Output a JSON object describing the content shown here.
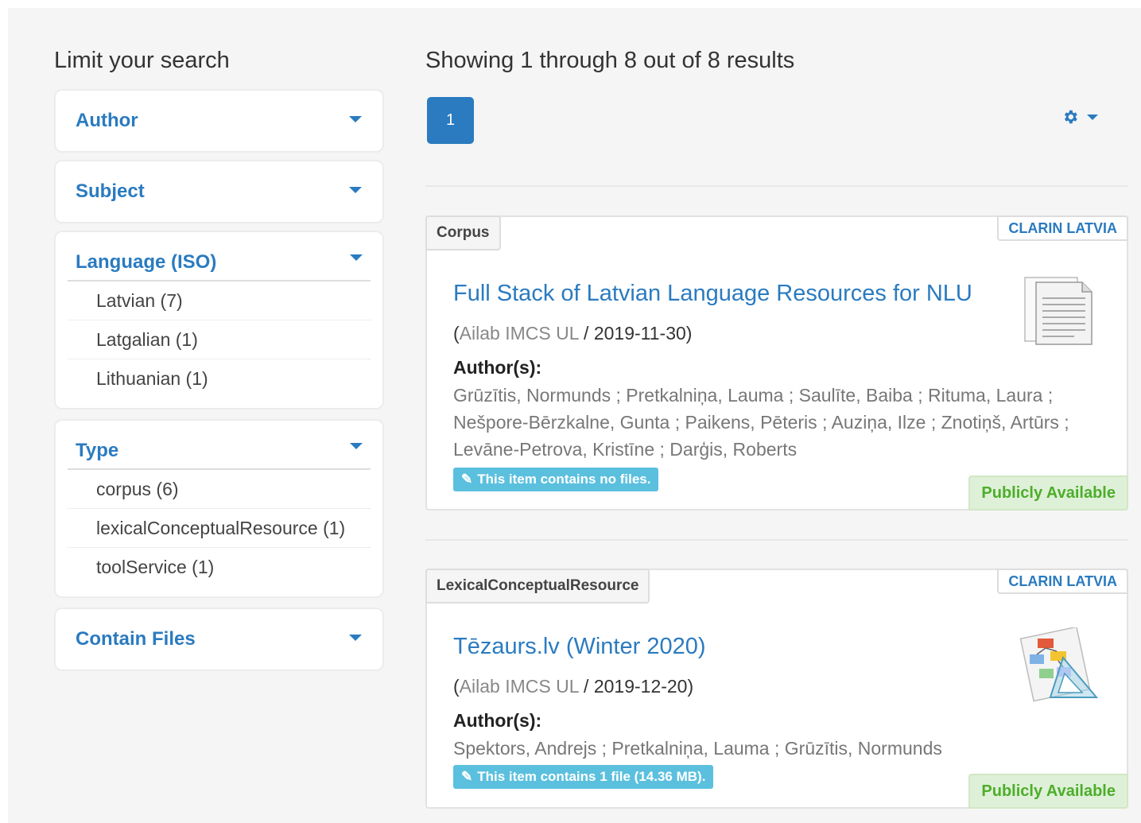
{
  "sidebar": {
    "title": "Limit your search",
    "facets": [
      {
        "title": "Author",
        "open": false,
        "items": []
      },
      {
        "title": "Subject",
        "open": false,
        "items": []
      },
      {
        "title": "Language (ISO)",
        "open": true,
        "items": [
          "Latvian (7)",
          "Latgalian (1)",
          "Lithuanian (1)"
        ]
      },
      {
        "title": "Type",
        "open": true,
        "items": [
          "corpus (6)",
          "lexicalConceptualResource (1)",
          "toolService (1)"
        ]
      },
      {
        "title": "Contain Files",
        "open": false,
        "items": []
      }
    ]
  },
  "results": {
    "summary": "Showing 1 through 8 out of 8 results",
    "pagination": {
      "current_page": "1"
    },
    "settings_icon": "gear-icon",
    "items": [
      {
        "type": "Corpus",
        "source": "CLARIN LATVIA",
        "title": "Full Stack of Latvian Language Resources for NLU",
        "meta_open": "(",
        "publisher": "Ailab IMCS UL",
        "meta_sep": " / ",
        "date": "2019-11-30",
        "meta_close": ")",
        "authors_label": "Author(s):",
        "authors": "Grūzītis, Normunds ; Pretkalniņa, Lauma ; Saulīte, Baiba ; Rituma, Laura ; Nešpore-Bērzkalne, Gunta ; Paikens, Pēteris ; Auziņa, Ilze ; Znotiņš, Artūrs ; Levāne-Petrova, Kristīne ; Darģis, Roberts",
        "files": "This item contains no files.",
        "access": "Publicly Available",
        "thumbnail_icon": "document-icon"
      },
      {
        "type": "LexicalConceptualResource",
        "source": "CLARIN LATVIA",
        "title": "Tēzaurs.lv (Winter 2020)",
        "meta_open": "(",
        "publisher": "Ailab IMCS UL",
        "meta_sep": " / ",
        "date": "2019-12-20",
        "meta_close": ")",
        "authors_label": "Author(s):",
        "authors": "Spektors, Andrejs ; Pretkalniņa, Lauma ; Grūzītis, Normunds",
        "files": "This item contains 1 file (14.36 MB).",
        "access": "Publicly Available",
        "thumbnail_icon": "diagram-icon"
      }
    ]
  },
  "colors": {
    "link": "#2a7bc0",
    "badge_info": "#5bc0de",
    "access_green": "#4cae2a"
  }
}
